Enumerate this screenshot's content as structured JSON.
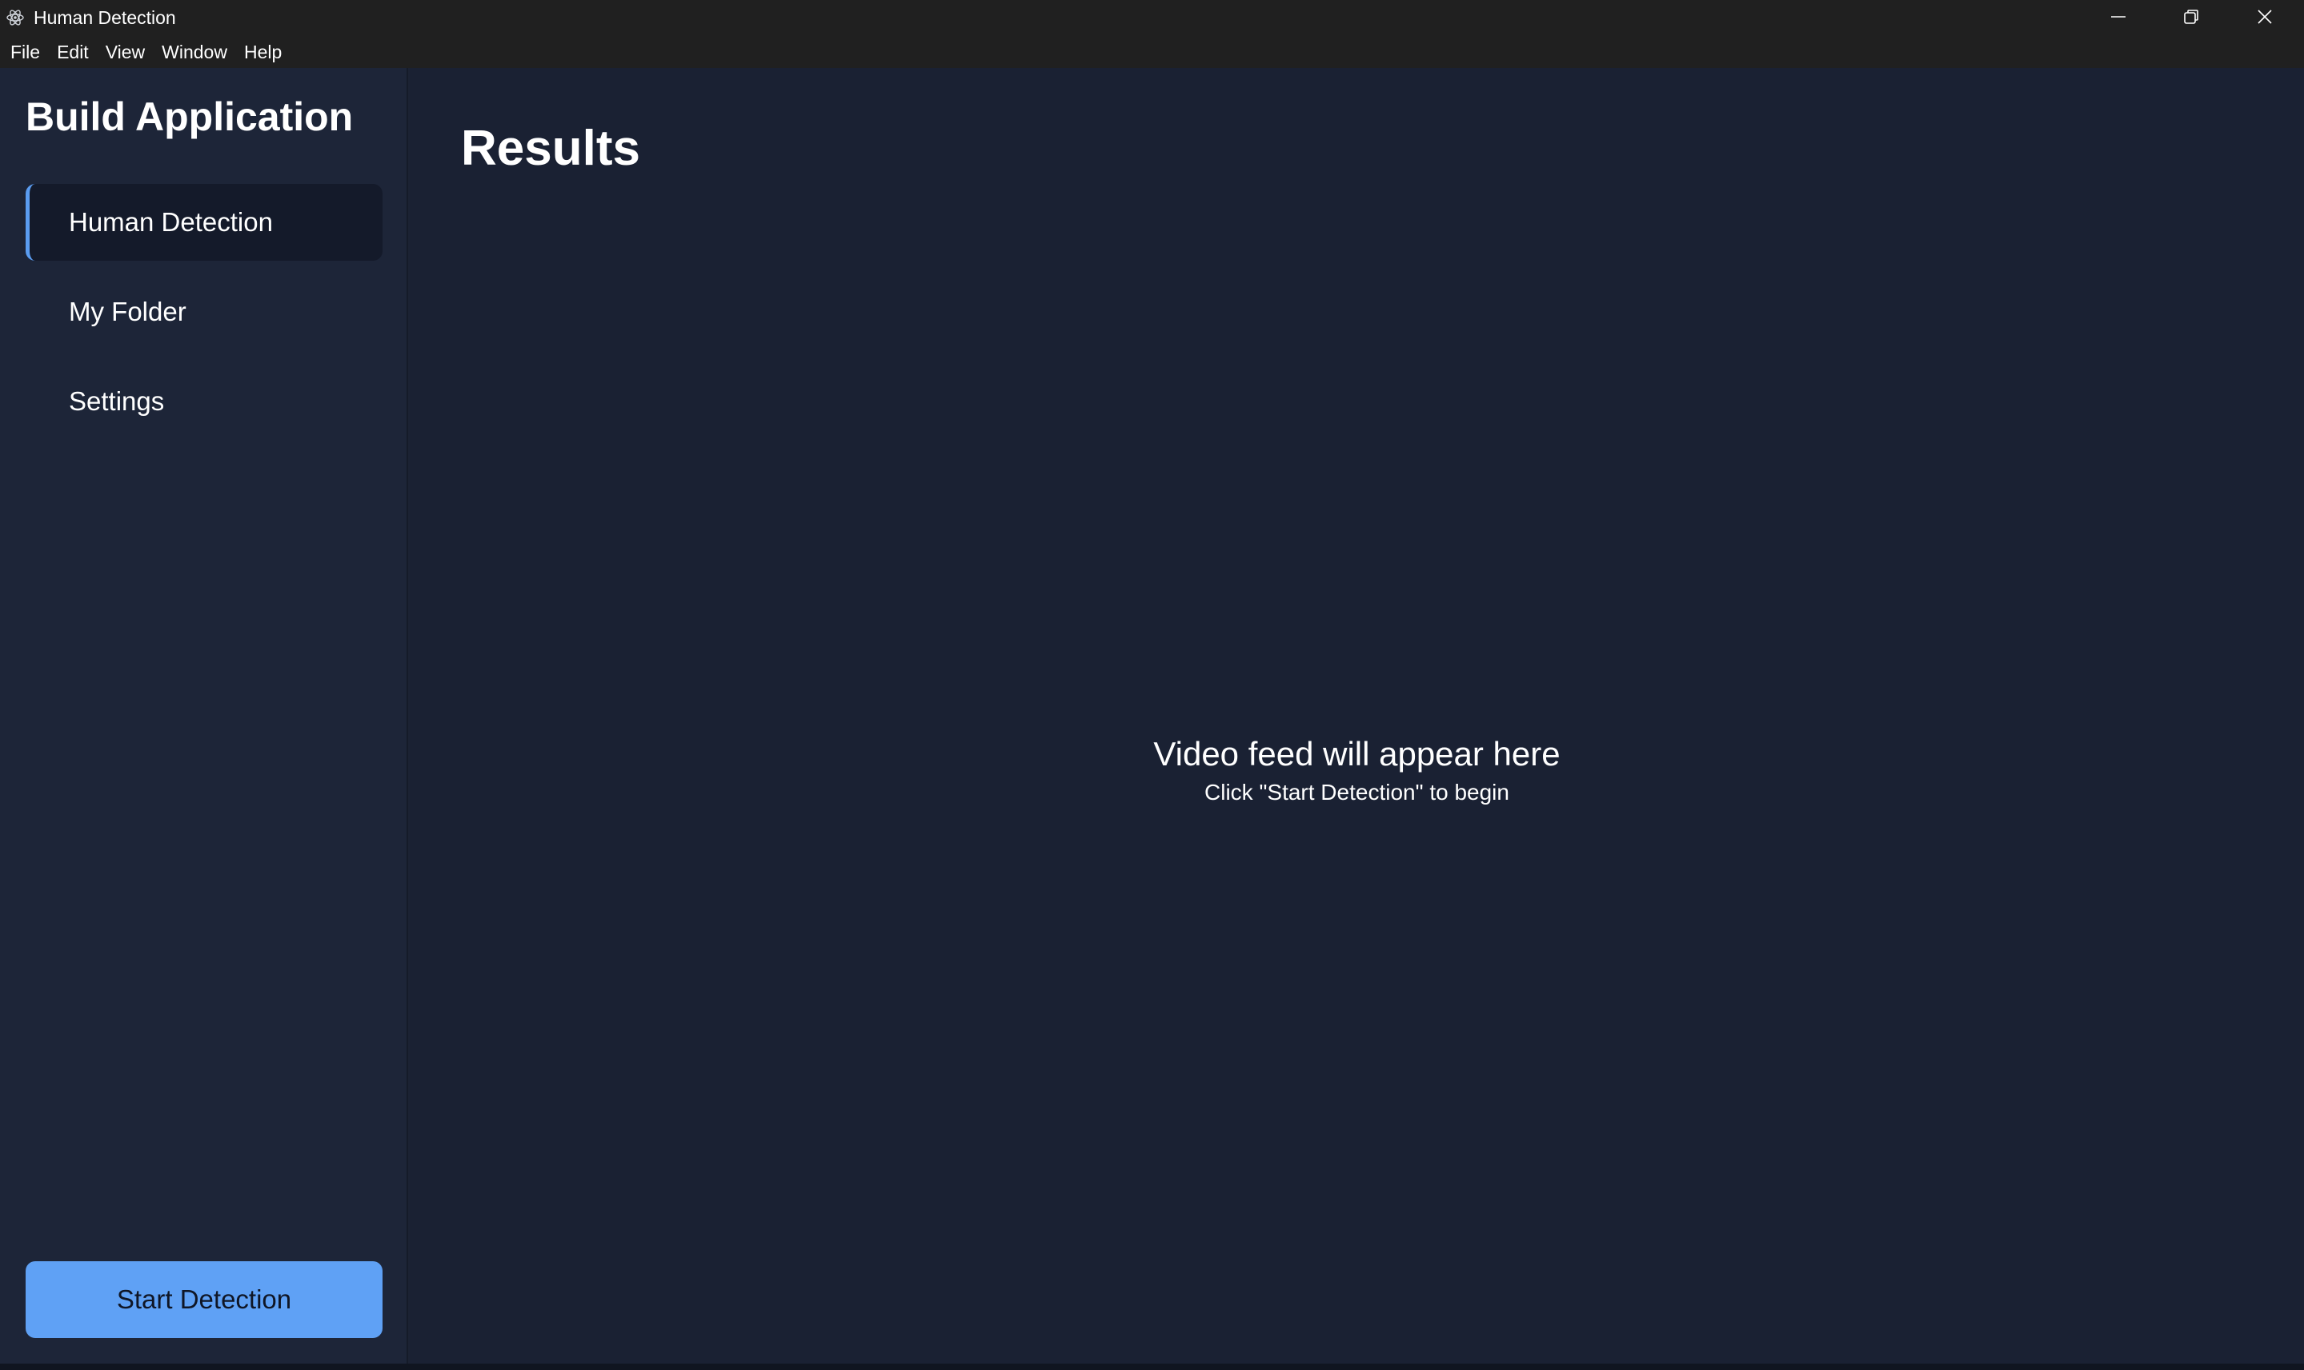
{
  "window": {
    "title": "Human Detection",
    "icon": "electron-atom-icon",
    "controls": [
      "minimize-icon",
      "restore-icon",
      "close-icon"
    ]
  },
  "menu": {
    "items": [
      "File",
      "Edit",
      "View",
      "Window",
      "Help"
    ]
  },
  "sidebar": {
    "title": "Build Application",
    "items": [
      {
        "label": "Human Detection",
        "active": true
      },
      {
        "label": "My Folder",
        "active": false
      },
      {
        "label": "Settings",
        "active": false
      }
    ],
    "start_button": "Start Detection"
  },
  "main": {
    "title": "Results",
    "placeholder_main": "Video feed will appear here",
    "placeholder_sub": "Click \"Start Detection\" to begin"
  },
  "colors": {
    "accent": "#5fa1f5",
    "sidebar_bg": "#1d2538",
    "main_bg": "#1a2133",
    "titlebar_bg": "#202020"
  }
}
